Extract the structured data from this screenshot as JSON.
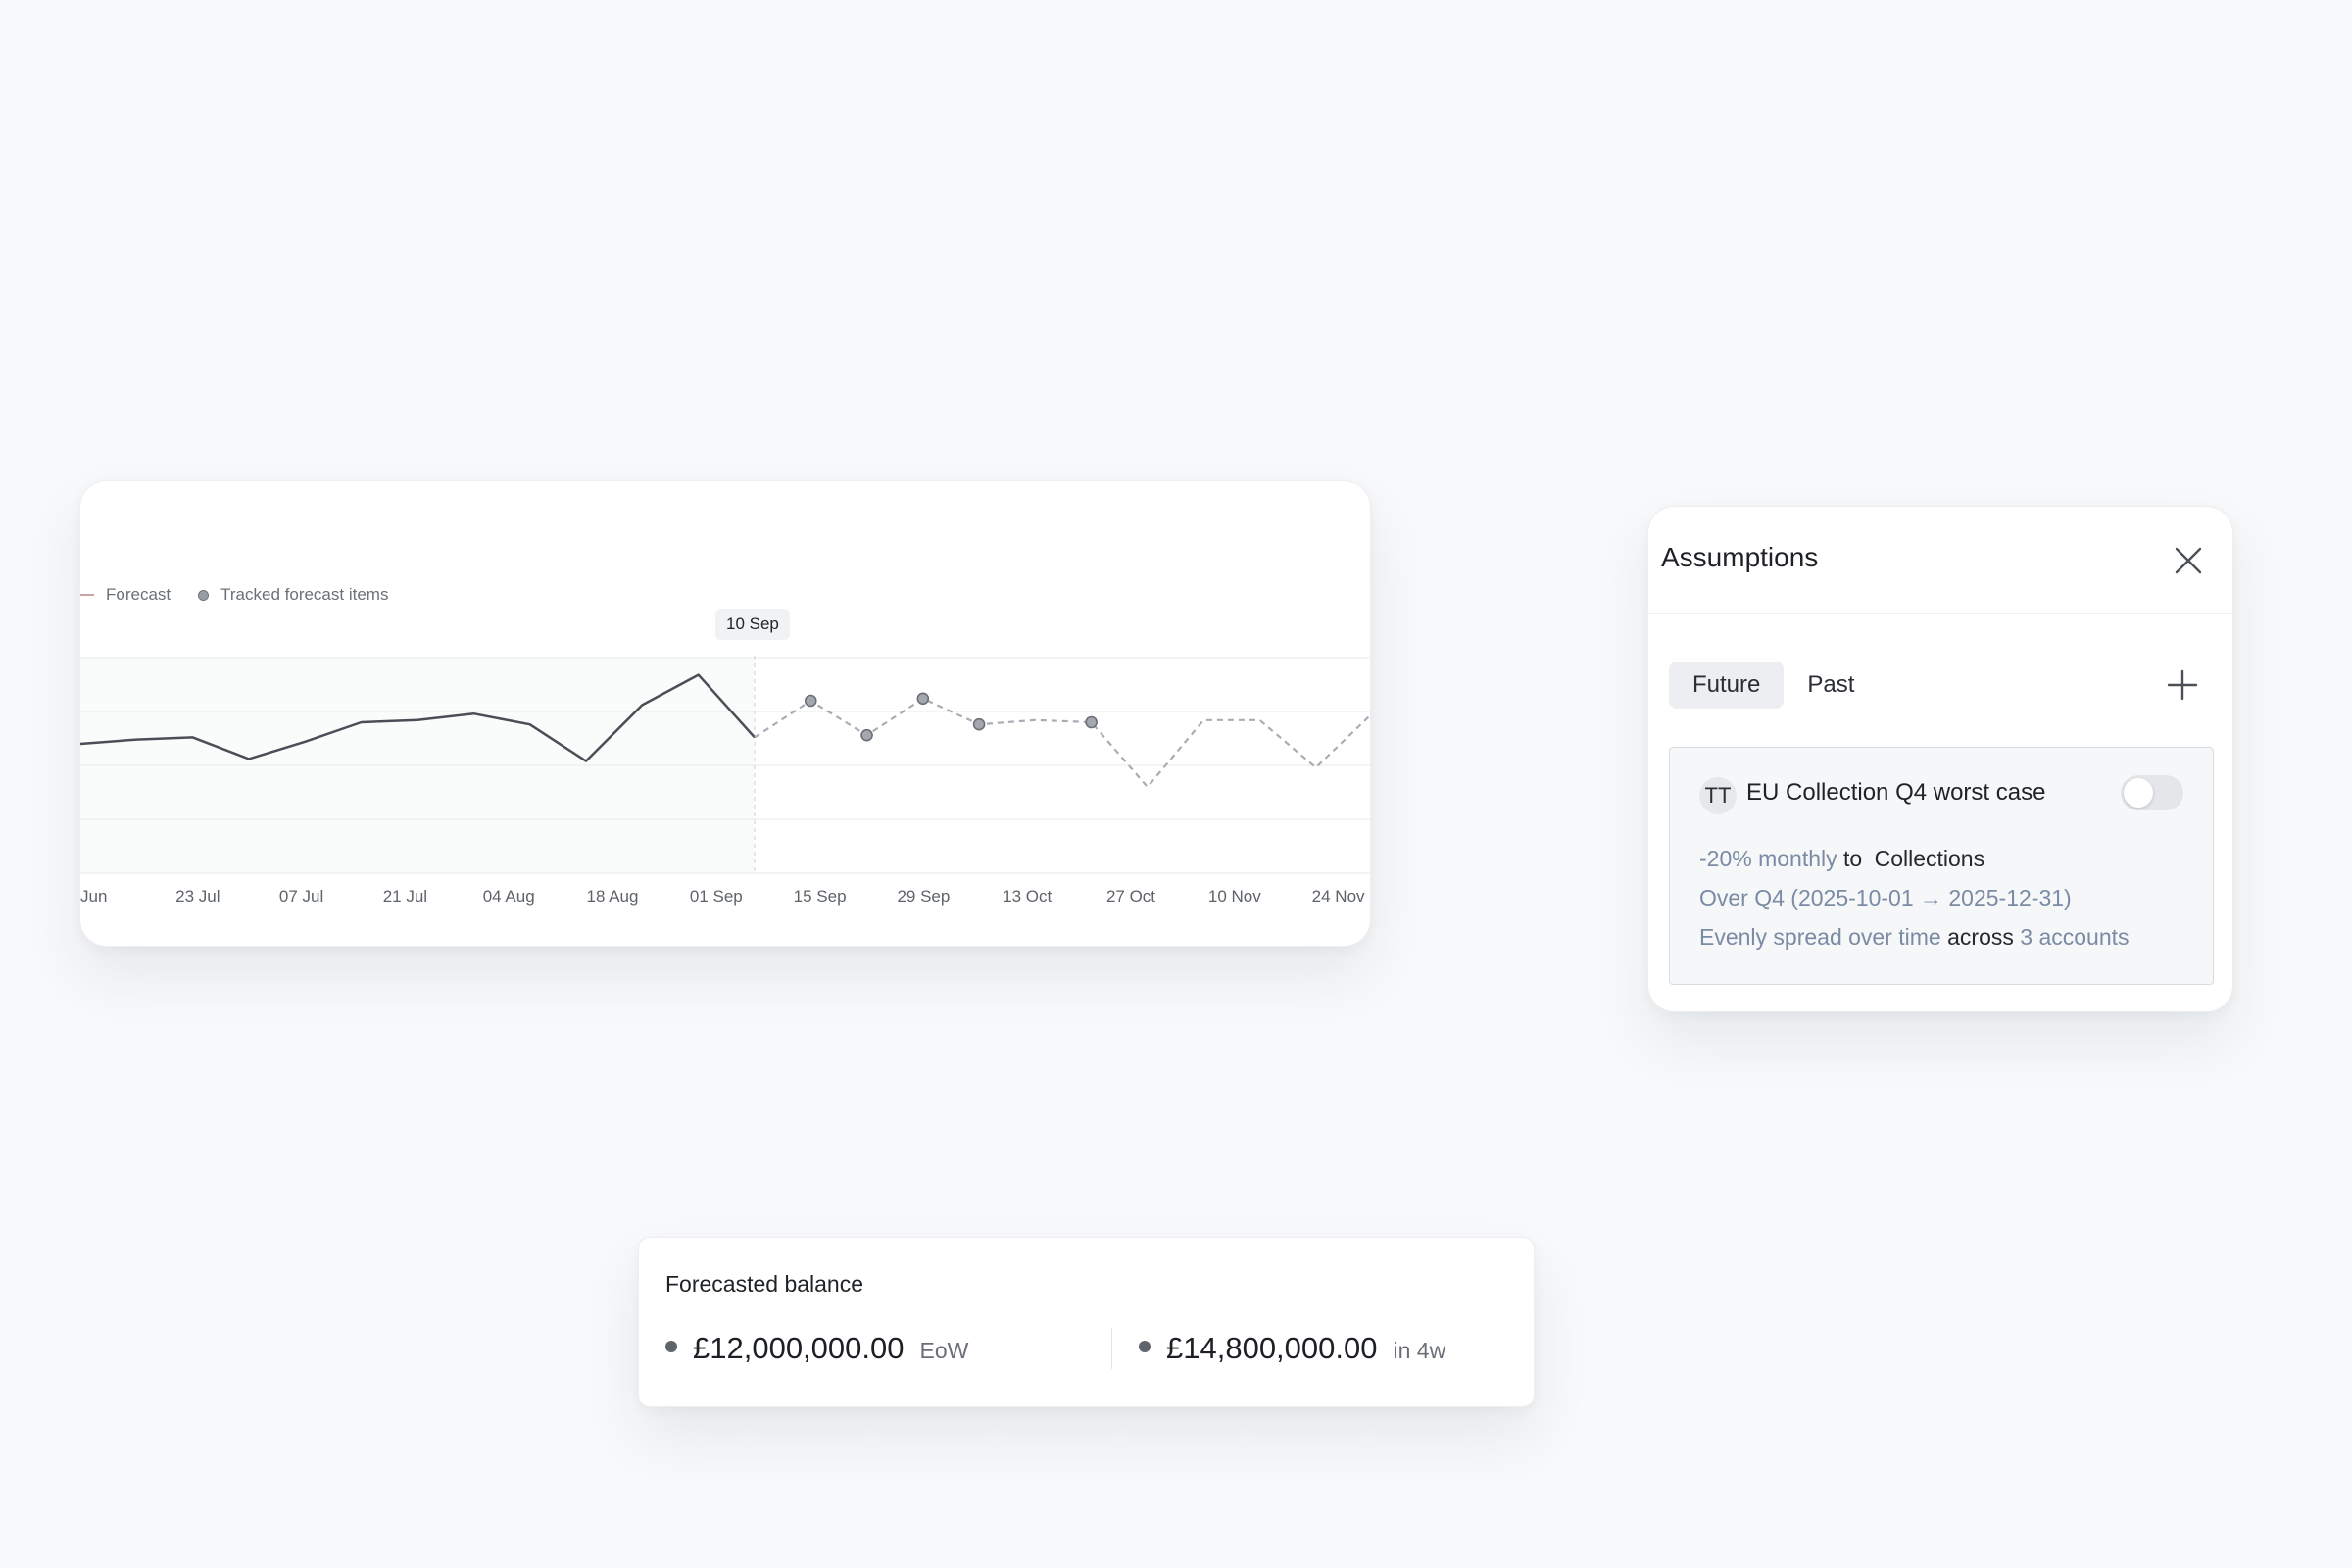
{
  "chart": {
    "legend": {
      "forecast": "Forecast",
      "tracked": "Tracked forecast items"
    },
    "tooltip_label": "10 Sep",
    "x_ticks": [
      "Jun",
      "23 Jul",
      "07 Jul",
      "21 Jul",
      "04 Aug",
      "18 Aug",
      "01 Sep",
      "15 Sep",
      "29 Sep",
      "13 Oct",
      "27 Oct",
      "10 Nov",
      "24 Nov"
    ]
  },
  "chart_data": {
    "type": "line",
    "x": [
      "Jun",
      "23 Jul",
      "07 Jul",
      "21 Jul",
      "04 Aug",
      "18 Aug",
      "01 Sep",
      "15 Sep",
      "29 Sep",
      "13 Oct",
      "27 Oct",
      "10 Nov",
      "24 Nov"
    ],
    "series": [
      {
        "name": "Forecast",
        "style": "solid",
        "values": [
          60,
          62,
          63,
          53,
          61,
          70,
          71,
          74,
          69,
          52,
          78,
          92,
          63
        ]
      },
      {
        "name": "Forecast",
        "style": "dashed",
        "values": [
          63,
          80,
          64,
          81,
          69,
          71,
          70,
          40,
          71,
          71,
          49,
          74
        ]
      },
      {
        "name": "Tracked forecast items",
        "style": "points",
        "values": [
          80,
          64,
          81,
          69,
          70
        ]
      }
    ],
    "highlight": "10 Sep",
    "grid": true,
    "legend_position": "top-left",
    "colors": {
      "solid": "#4a4f57",
      "dashed": "#a9adb3",
      "point_fill": "#a4a8ae",
      "point_stroke": "#6b7078"
    }
  },
  "assumptions": {
    "title": "Assumptions",
    "tabs": [
      "Future",
      "Past"
    ],
    "active_tab": "Future",
    "scenario": {
      "avatar": "TT",
      "title": "EU Collection Q4 worst case",
      "toggle_on": false,
      "amount": "-20% monthly",
      "to": "to",
      "target": "Collections",
      "period": "Over Q4 (2025-10-01 → 2025-12-31)",
      "spread": "Evenly spread over time",
      "across": "across",
      "accounts": "3 accounts"
    }
  },
  "balance": {
    "title": "Forecasted balance",
    "items": [
      {
        "amount": "£12,000,000.00",
        "suffix": "EoW"
      },
      {
        "amount": "£14,800,000.00",
        "suffix": "in 4w"
      }
    ]
  }
}
